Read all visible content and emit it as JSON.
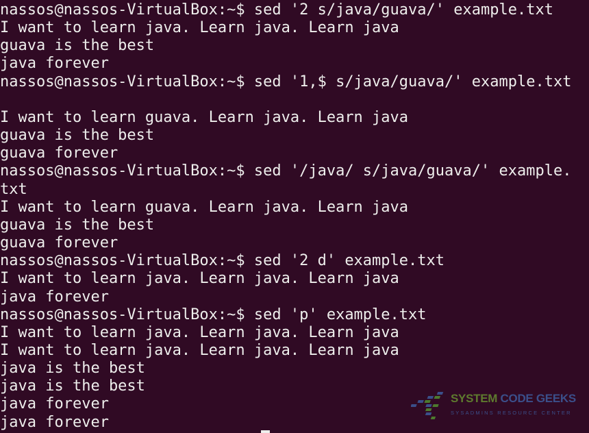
{
  "terminal": {
    "background": "#300a24",
    "foreground": "#eeeeec",
    "lines": [
      "nassos@nassos-VirtualBox:~$ sed '2 s/java/guava/' example.txt",
      "I want to learn java. Learn java. Learn java",
      "guava is the best",
      "java forever",
      "nassos@nassos-VirtualBox:~$ sed '1,$ s/java/guava/' example.txt",
      "",
      "I want to learn guava. Learn java. Learn java",
      "guava is the best",
      "guava forever",
      "nassos@nassos-VirtualBox:~$ sed '/java/ s/java/guava/' example.",
      "txt",
      "I want to learn guava. Learn java. Learn java",
      "guava is the best",
      "guava forever",
      "nassos@nassos-VirtualBox:~$ sed '2 d' example.txt",
      "I want to learn java. Learn java. Learn java",
      "java forever",
      "nassos@nassos-VirtualBox:~$ sed 'p' example.txt",
      "I want to learn java. Learn java. Learn java",
      "I want to learn java. Learn java. Learn java",
      "java is the best",
      "java is the best",
      "java forever",
      "java forever"
    ]
  },
  "watermark": {
    "title_a": "SYSTEM",
    "title_b": "CODE GEEKS",
    "subtitle": "SYSADMINS RESOURCE CENTER",
    "color_a": "#5e7a2e",
    "color_b": "#3b4f8a"
  }
}
